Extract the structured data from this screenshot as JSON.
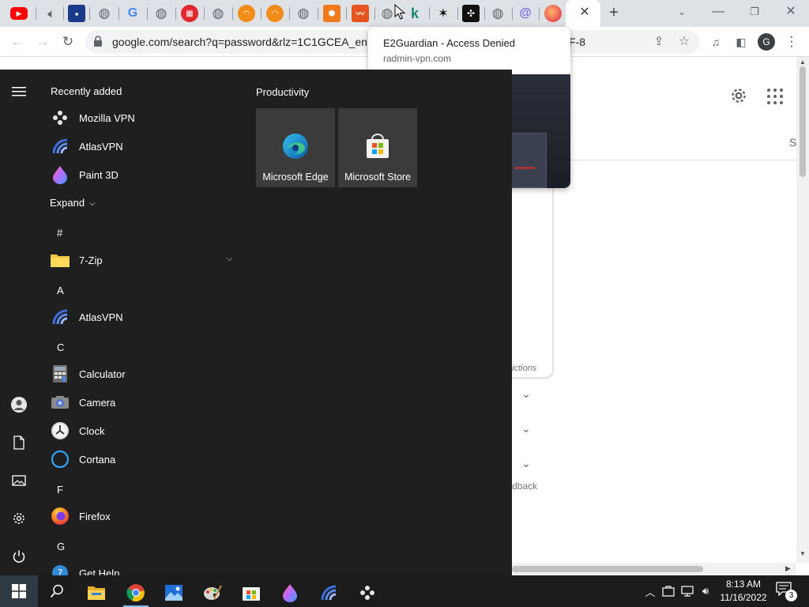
{
  "browser": {
    "url_visible": "google.com/search?q=password&rlz=1C1GCEA_enU",
    "url_tail": "F-8",
    "profile_initial": "G",
    "tab_close_glyph": "✕",
    "new_tab_glyph": "+",
    "tooltip": {
      "title": "E2Guardian - Access Denied",
      "domain": "radmin-vpn.com"
    }
  },
  "page": {
    "partial_s": "S",
    "restrictions_partial": "ictions",
    "feedback_partial": "dback"
  },
  "start_menu": {
    "recently_added_heading": "Recently added",
    "recent_apps": [
      {
        "label": "Mozilla VPN",
        "icon": "mozilla-vpn-icon"
      },
      {
        "label": "AtlasVPN",
        "icon": "atlasvpn-icon"
      },
      {
        "label": "Paint 3D",
        "icon": "paint3d-icon"
      }
    ],
    "expand_label": "Expand",
    "groups": [
      {
        "letter": "#",
        "apps": [
          {
            "label": "7-Zip",
            "icon": "folder-icon"
          }
        ]
      },
      {
        "letter": "A",
        "apps": [
          {
            "label": "AtlasVPN",
            "icon": "atlasvpn-icon"
          }
        ]
      },
      {
        "letter": "C",
        "apps": [
          {
            "label": "Calculator",
            "icon": "calculator-icon"
          },
          {
            "label": "Camera",
            "icon": "camera-icon"
          },
          {
            "label": "Clock",
            "icon": "clock-icon"
          },
          {
            "label": "Cortana",
            "icon": "cortana-icon"
          }
        ]
      },
      {
        "letter": "F",
        "apps": [
          {
            "label": "Firefox",
            "icon": "firefox-icon"
          }
        ]
      },
      {
        "letter": "G",
        "apps": [
          {
            "label": "Get Help",
            "icon": "get-help-icon"
          }
        ]
      }
    ],
    "tiles_heading": "Productivity",
    "tiles": [
      {
        "label": "Microsoft Edge",
        "icon": "edge-icon"
      },
      {
        "label": "Microsoft Store",
        "icon": "store-icon"
      }
    ]
  },
  "taskbar": {
    "time": "8:13 AM",
    "date": "11/16/2022",
    "notification_count": "3"
  }
}
